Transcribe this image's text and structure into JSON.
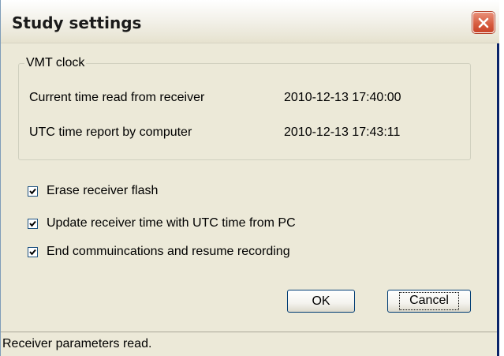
{
  "window": {
    "title": "Study settings"
  },
  "vmt_clock": {
    "legend": "VMT clock",
    "rows": [
      {
        "label": "Current time read from receiver",
        "value": "2010-12-13 17:40:00"
      },
      {
        "label": "UTC time report by computer",
        "value": "2010-12-13 17:43:11"
      }
    ]
  },
  "options": [
    {
      "label": "Erase receiver flash",
      "checked": true
    },
    {
      "label": "Update receiver time with UTC time from PC",
      "checked": true
    },
    {
      "label": "End commuincations and resume recording",
      "checked": true
    }
  ],
  "buttons": {
    "ok": "OK",
    "cancel": "Cancel"
  },
  "status": {
    "text": "Receiver parameters read."
  },
  "colors": {
    "dialog_bg": "#ece9d8",
    "close_button": "#d65b3e",
    "check_mark": "#000000"
  },
  "icons": {
    "close": "close-icon",
    "check": "check-icon"
  }
}
